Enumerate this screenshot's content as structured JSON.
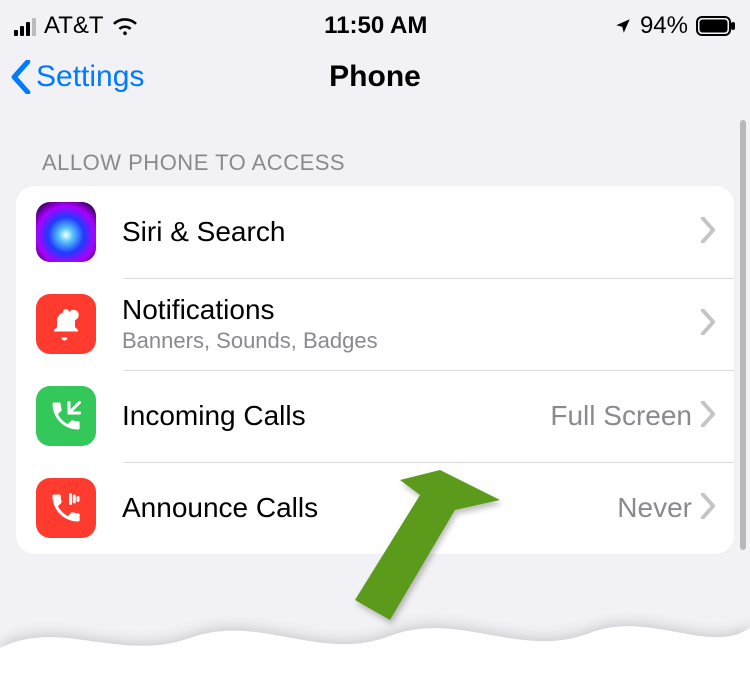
{
  "status": {
    "carrier": "AT&T",
    "time": "11:50 AM",
    "battery_pct": "94%"
  },
  "nav": {
    "back_label": "Settings",
    "title": "Phone"
  },
  "section_header": "ALLOW PHONE TO ACCESS",
  "rows": {
    "siri": {
      "title": "Siri & Search"
    },
    "notif": {
      "title": "Notifications",
      "sub": "Banners, Sounds, Badges"
    },
    "incoming": {
      "title": "Incoming Calls",
      "value": "Full Screen"
    },
    "announce": {
      "title": "Announce Calls",
      "value": "Never"
    }
  }
}
